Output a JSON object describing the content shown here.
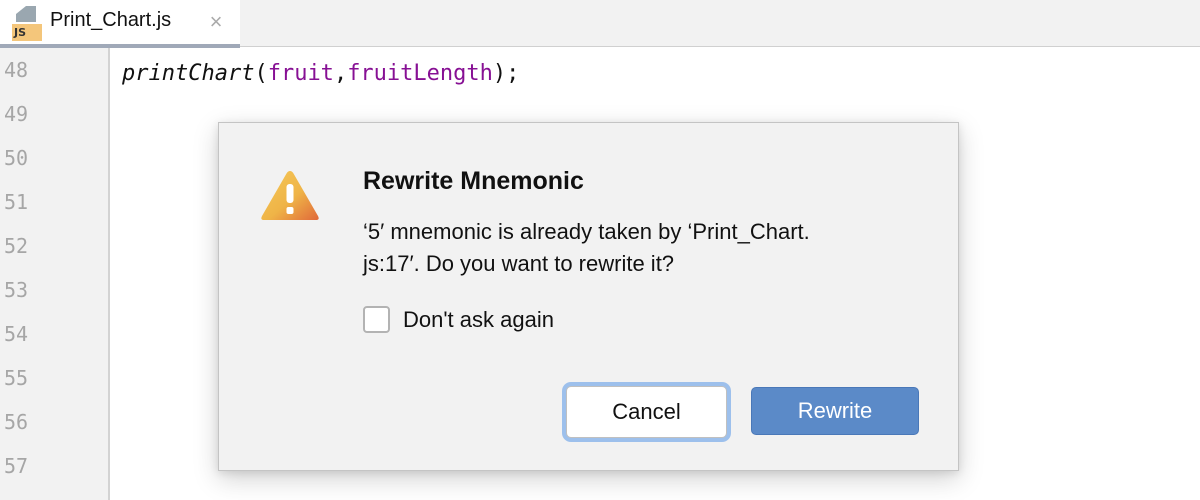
{
  "tab": {
    "file_badge": "JS",
    "title": "Print_Chart.js",
    "close_glyph": "×"
  },
  "gutter": {
    "line_numbers": [
      "48",
      "49",
      "50",
      "51",
      "52",
      "53",
      "54",
      "55",
      "56",
      "57"
    ]
  },
  "code": {
    "line_48": {
      "function_name": "printChart",
      "open_paren": "(",
      "arg1": "fruit",
      "comma": ",",
      "arg2": "fruitLength",
      "close": ");"
    }
  },
  "dialog": {
    "icon": "warning-icon",
    "title": "Rewrite Mnemonic",
    "message": "‘5′ mnemonic is already taken by ‘Print_Chart.js:17′. Do you want to rewrite it?",
    "message_line1": "‘5′ mnemonic is already taken by ‘Print_Chart.",
    "message_line2": "js:17′. Do you want to rewrite it?",
    "checkbox_label": "Don't ask again",
    "checkbox_checked": false,
    "cancel_label": "Cancel",
    "rewrite_label": "Rewrite"
  },
  "colors": {
    "primary_button": "#5b8ac8",
    "focus_ring": "#9dc0ec",
    "code_variable": "#871094",
    "warning_start": "#f5c95a",
    "warning_end": "#e0683a"
  }
}
